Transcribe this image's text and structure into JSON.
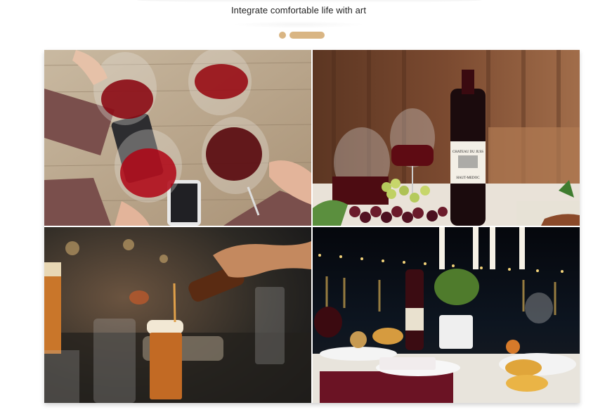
{
  "header": {
    "subtitle": "Integrate comfortable life with art",
    "indicator": {
      "count": 2,
      "active_index": 1
    }
  },
  "gallery": {
    "tiles": [
      {
        "id": "tile-red-wine-toast",
        "icon": "photo-wine-glasses-toast"
      },
      {
        "id": "tile-wine-bottle-grapes",
        "icon": "photo-wine-bottle-grapes",
        "bottle_label": "CHATEAU DU JUSS",
        "bottle_sub": "HAUT-MEDOC"
      },
      {
        "id": "tile-beer-pour",
        "icon": "photo-beer-pour"
      },
      {
        "id": "tile-night-dinner",
        "icon": "photo-night-dinner-table"
      }
    ]
  },
  "colors": {
    "accent": "#d9b583",
    "text": "#222222",
    "background": "#ffffff"
  }
}
